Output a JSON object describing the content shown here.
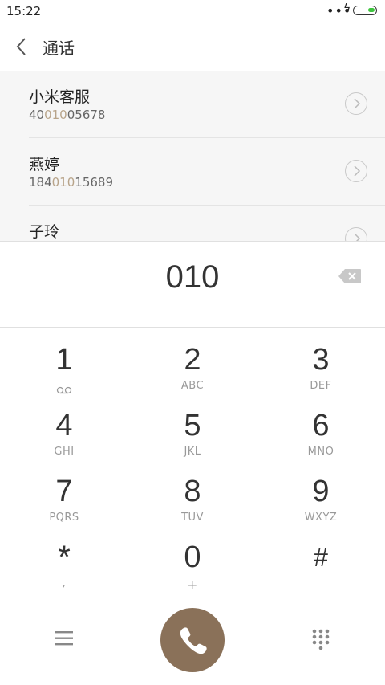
{
  "status_bar": {
    "time": "15:22",
    "dots": "•••",
    "bolt": "ϟ",
    "battery_color": "#3ec43e"
  },
  "header": {
    "title": "通话"
  },
  "contacts": [
    {
      "name": "小米客服",
      "number_pre": "40",
      "number_match": "010",
      "number_post": "05678"
    },
    {
      "name": "燕婷",
      "number_pre": "184",
      "number_match": "010",
      "number_post": "15689"
    },
    {
      "name": "子玲",
      "number_pre": "",
      "number_match": "",
      "number_post": ""
    }
  ],
  "dial_input": {
    "digits": "010"
  },
  "keypad": [
    {
      "digit": "1",
      "letters": "",
      "icon": "voicemail-icon"
    },
    {
      "digit": "2",
      "letters": "ABC"
    },
    {
      "digit": "3",
      "letters": "DEF"
    },
    {
      "digit": "4",
      "letters": "GHI"
    },
    {
      "digit": "5",
      "letters": "JKL"
    },
    {
      "digit": "6",
      "letters": "MNO"
    },
    {
      "digit": "7",
      "letters": "PQRS"
    },
    {
      "digit": "8",
      "letters": "TUV"
    },
    {
      "digit": "9",
      "letters": "WXYZ"
    },
    {
      "digit": "*",
      "letters": ","
    },
    {
      "digit": "0",
      "letters": "+"
    },
    {
      "digit": "#",
      "letters": ""
    }
  ],
  "colors": {
    "accent": "#8a7159",
    "match_highlight": "#b8a48a",
    "list_bg": "#f6f6f6"
  },
  "bottom_bar": {
    "left_icon": "menu-icon",
    "center_icon": "phone-icon",
    "right_icon": "dialpad-icon"
  }
}
